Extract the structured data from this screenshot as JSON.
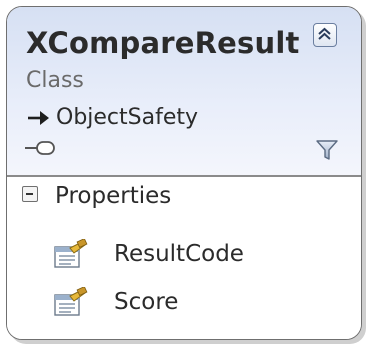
{
  "class_box": {
    "name": "XCompareResult",
    "stereotype": "Class",
    "base_type": "ObjectSafety",
    "collapse_icon": "double-chevron-up-icon",
    "filter_icon": "filter-icon",
    "interface_icon": "lollipop-icon"
  },
  "sections": [
    {
      "title": "Properties",
      "members": [
        {
          "name": "ResultCode",
          "icon": "property-icon"
        },
        {
          "name": "Score",
          "icon": "property-icon"
        }
      ]
    }
  ],
  "colors": {
    "header_gradient_top": "#d6e0f3",
    "header_gradient_bottom": "#f4f6fc",
    "border": "#6f6f6f",
    "text": "#2b2b2b",
    "stereotype_text": "#6a6a6a"
  }
}
